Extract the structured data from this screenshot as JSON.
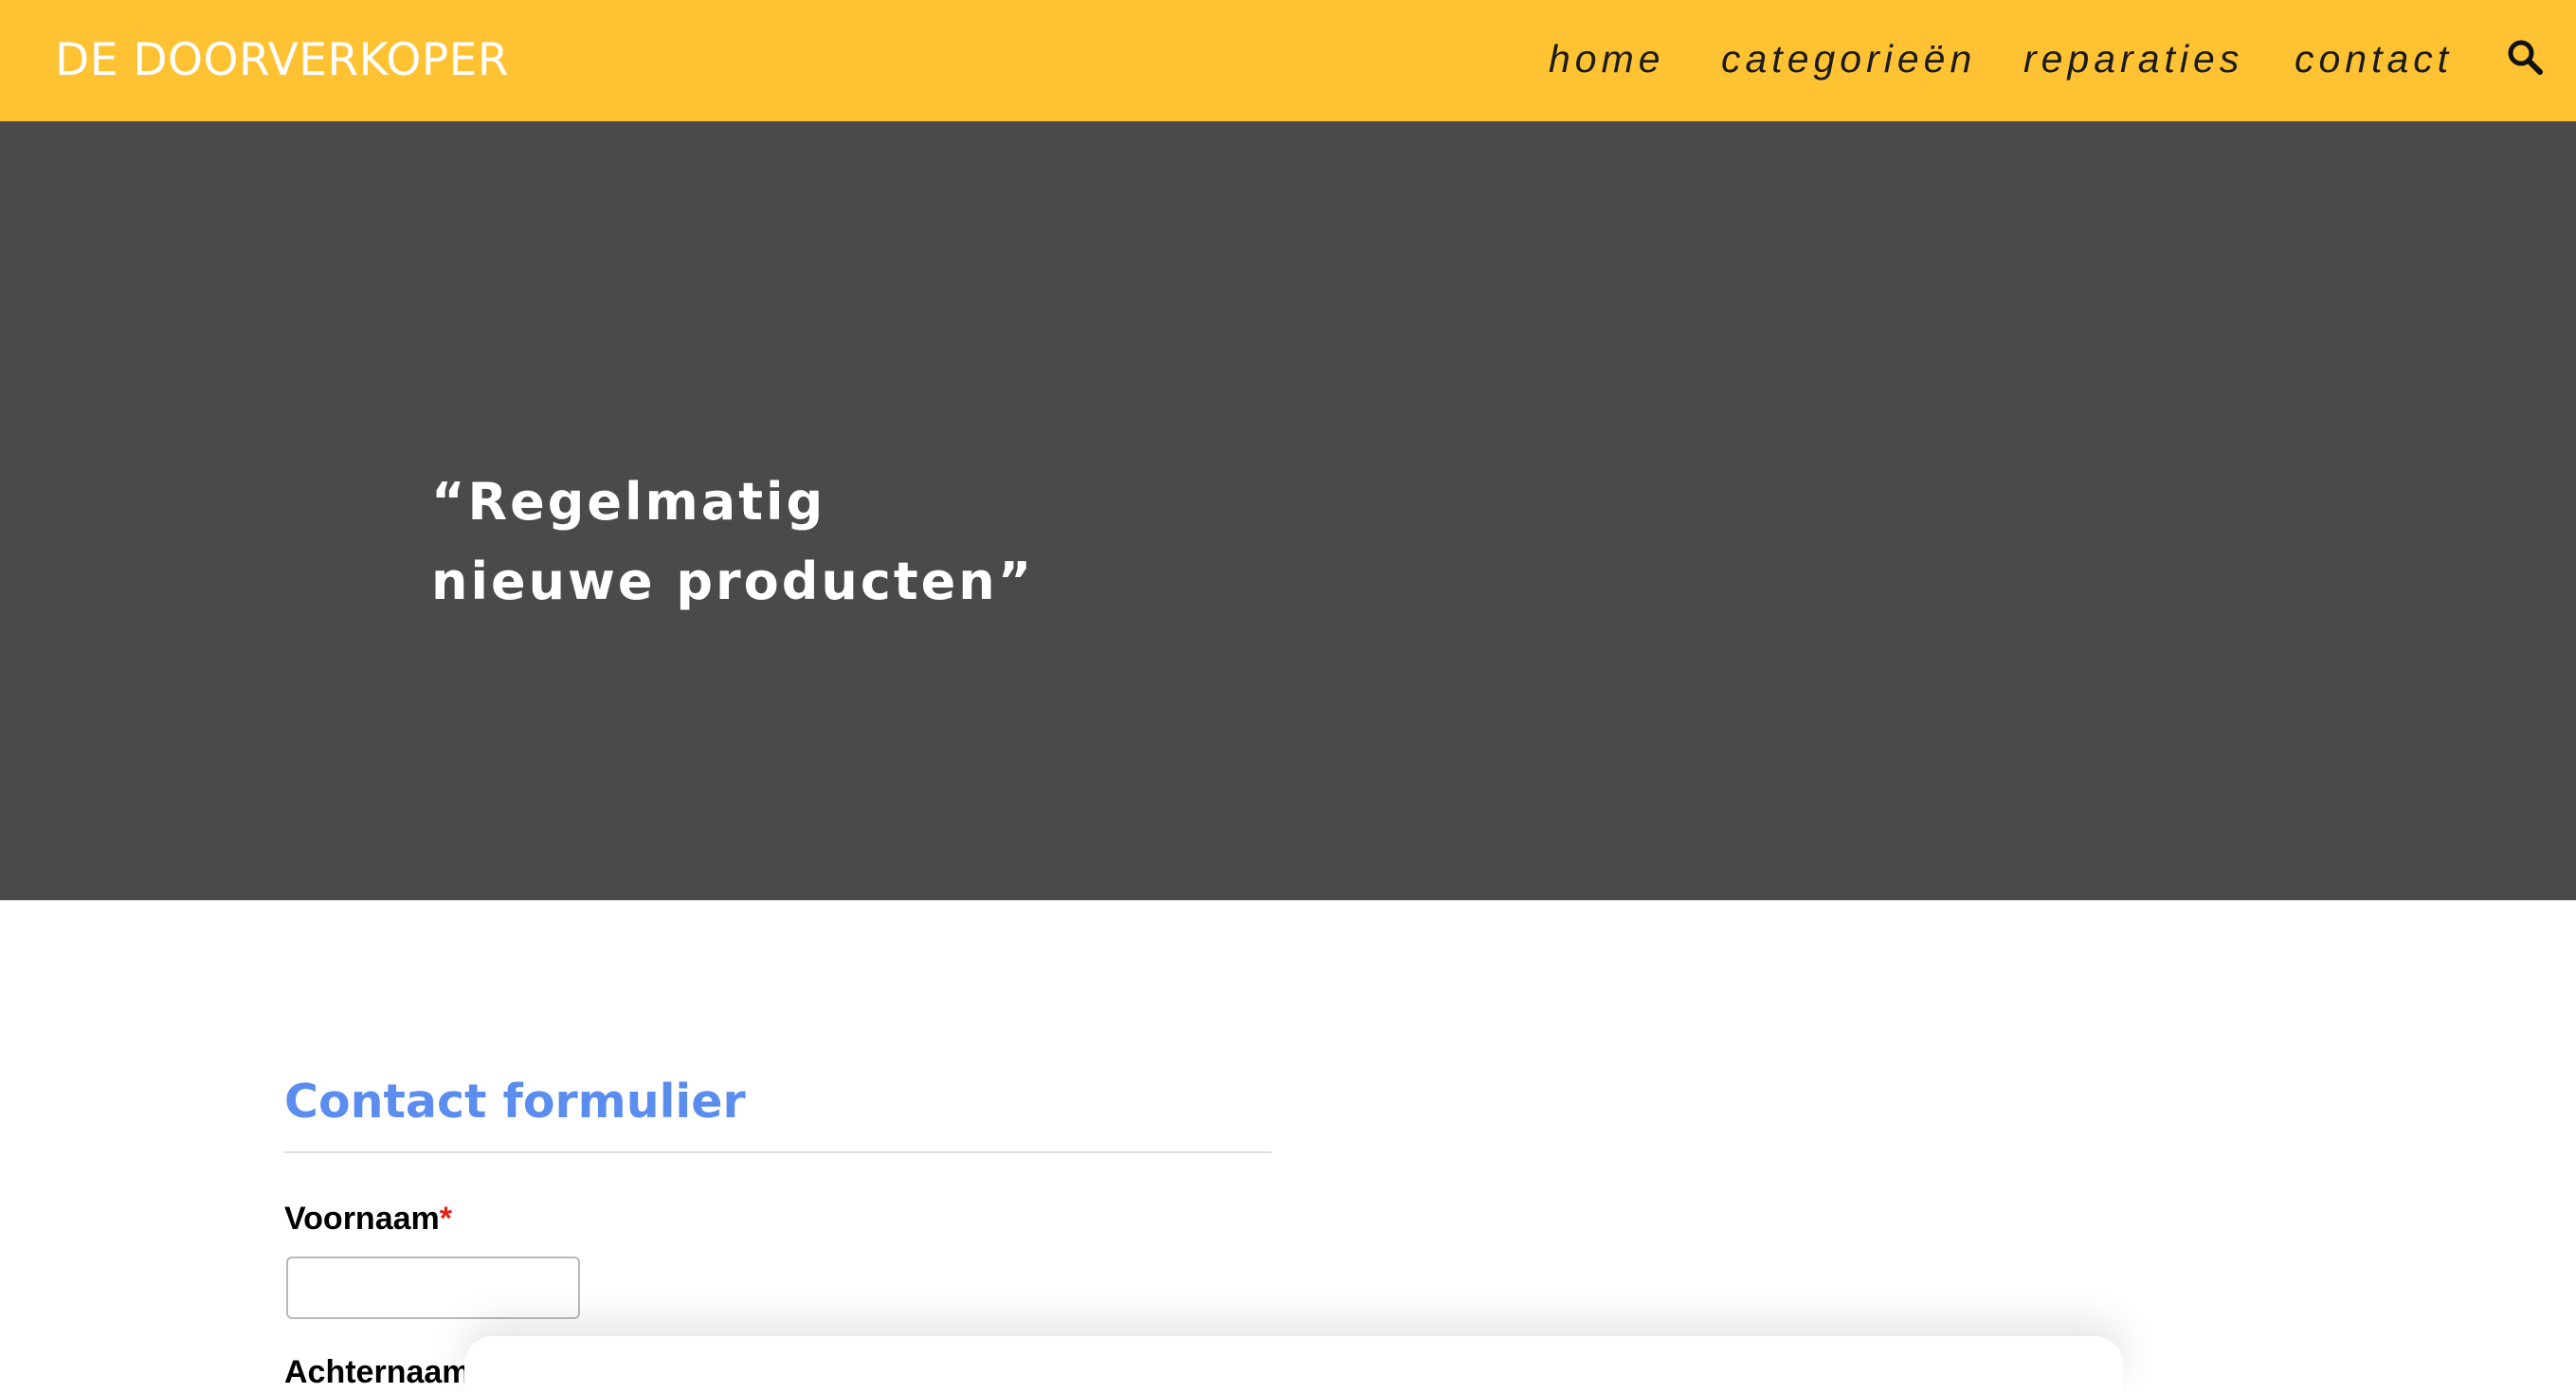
{
  "header": {
    "logo": "DE DOORVERKOPER",
    "nav": {
      "home": "home",
      "categories": "categorieën",
      "repairs": "reparaties",
      "contact": "contact"
    },
    "search_icon": "search-icon",
    "background_color": "#fec233"
  },
  "hero": {
    "quote_line1": "“Regelmatig",
    "quote_line2": "nieuwe producten”",
    "background_color": "#4a4a4a"
  },
  "form": {
    "title": "Contact formulier",
    "first_name_label": "Voornaam",
    "required_marker": "*",
    "first_name_value": "",
    "next_label_partial": "Achternaam",
    "title_color": "#5b8def"
  }
}
